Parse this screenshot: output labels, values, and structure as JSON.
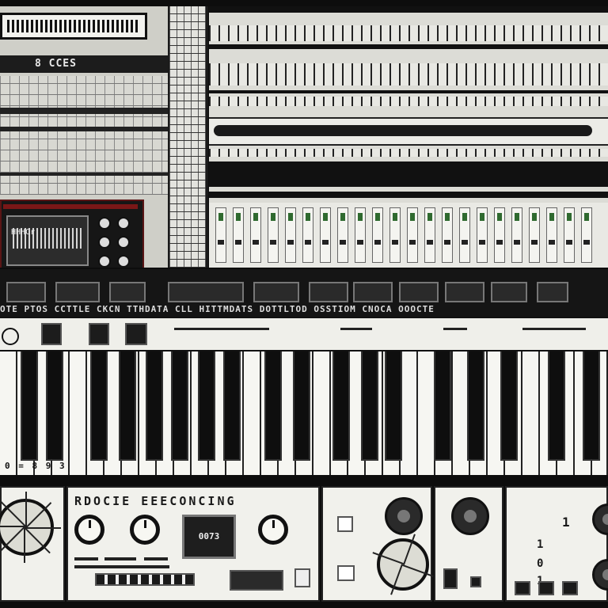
{
  "top_left": {
    "title": "8 CCES",
    "synth_display": "HHHCr"
  },
  "band": {
    "label": "OTE PTOS CCTTLE  CKCN TTHDATA CLL HITTMDATS  DOTTLTOD OSSTIOM CNOCA  OOOCTE"
  },
  "keyboard": {
    "footer": "0 = 8 9 3"
  },
  "bottom": {
    "module_title": "RDOCIE EEECONCING",
    "lcd_text": "0073",
    "right_digits": [
      "1",
      "1",
      "0",
      "1"
    ]
  }
}
